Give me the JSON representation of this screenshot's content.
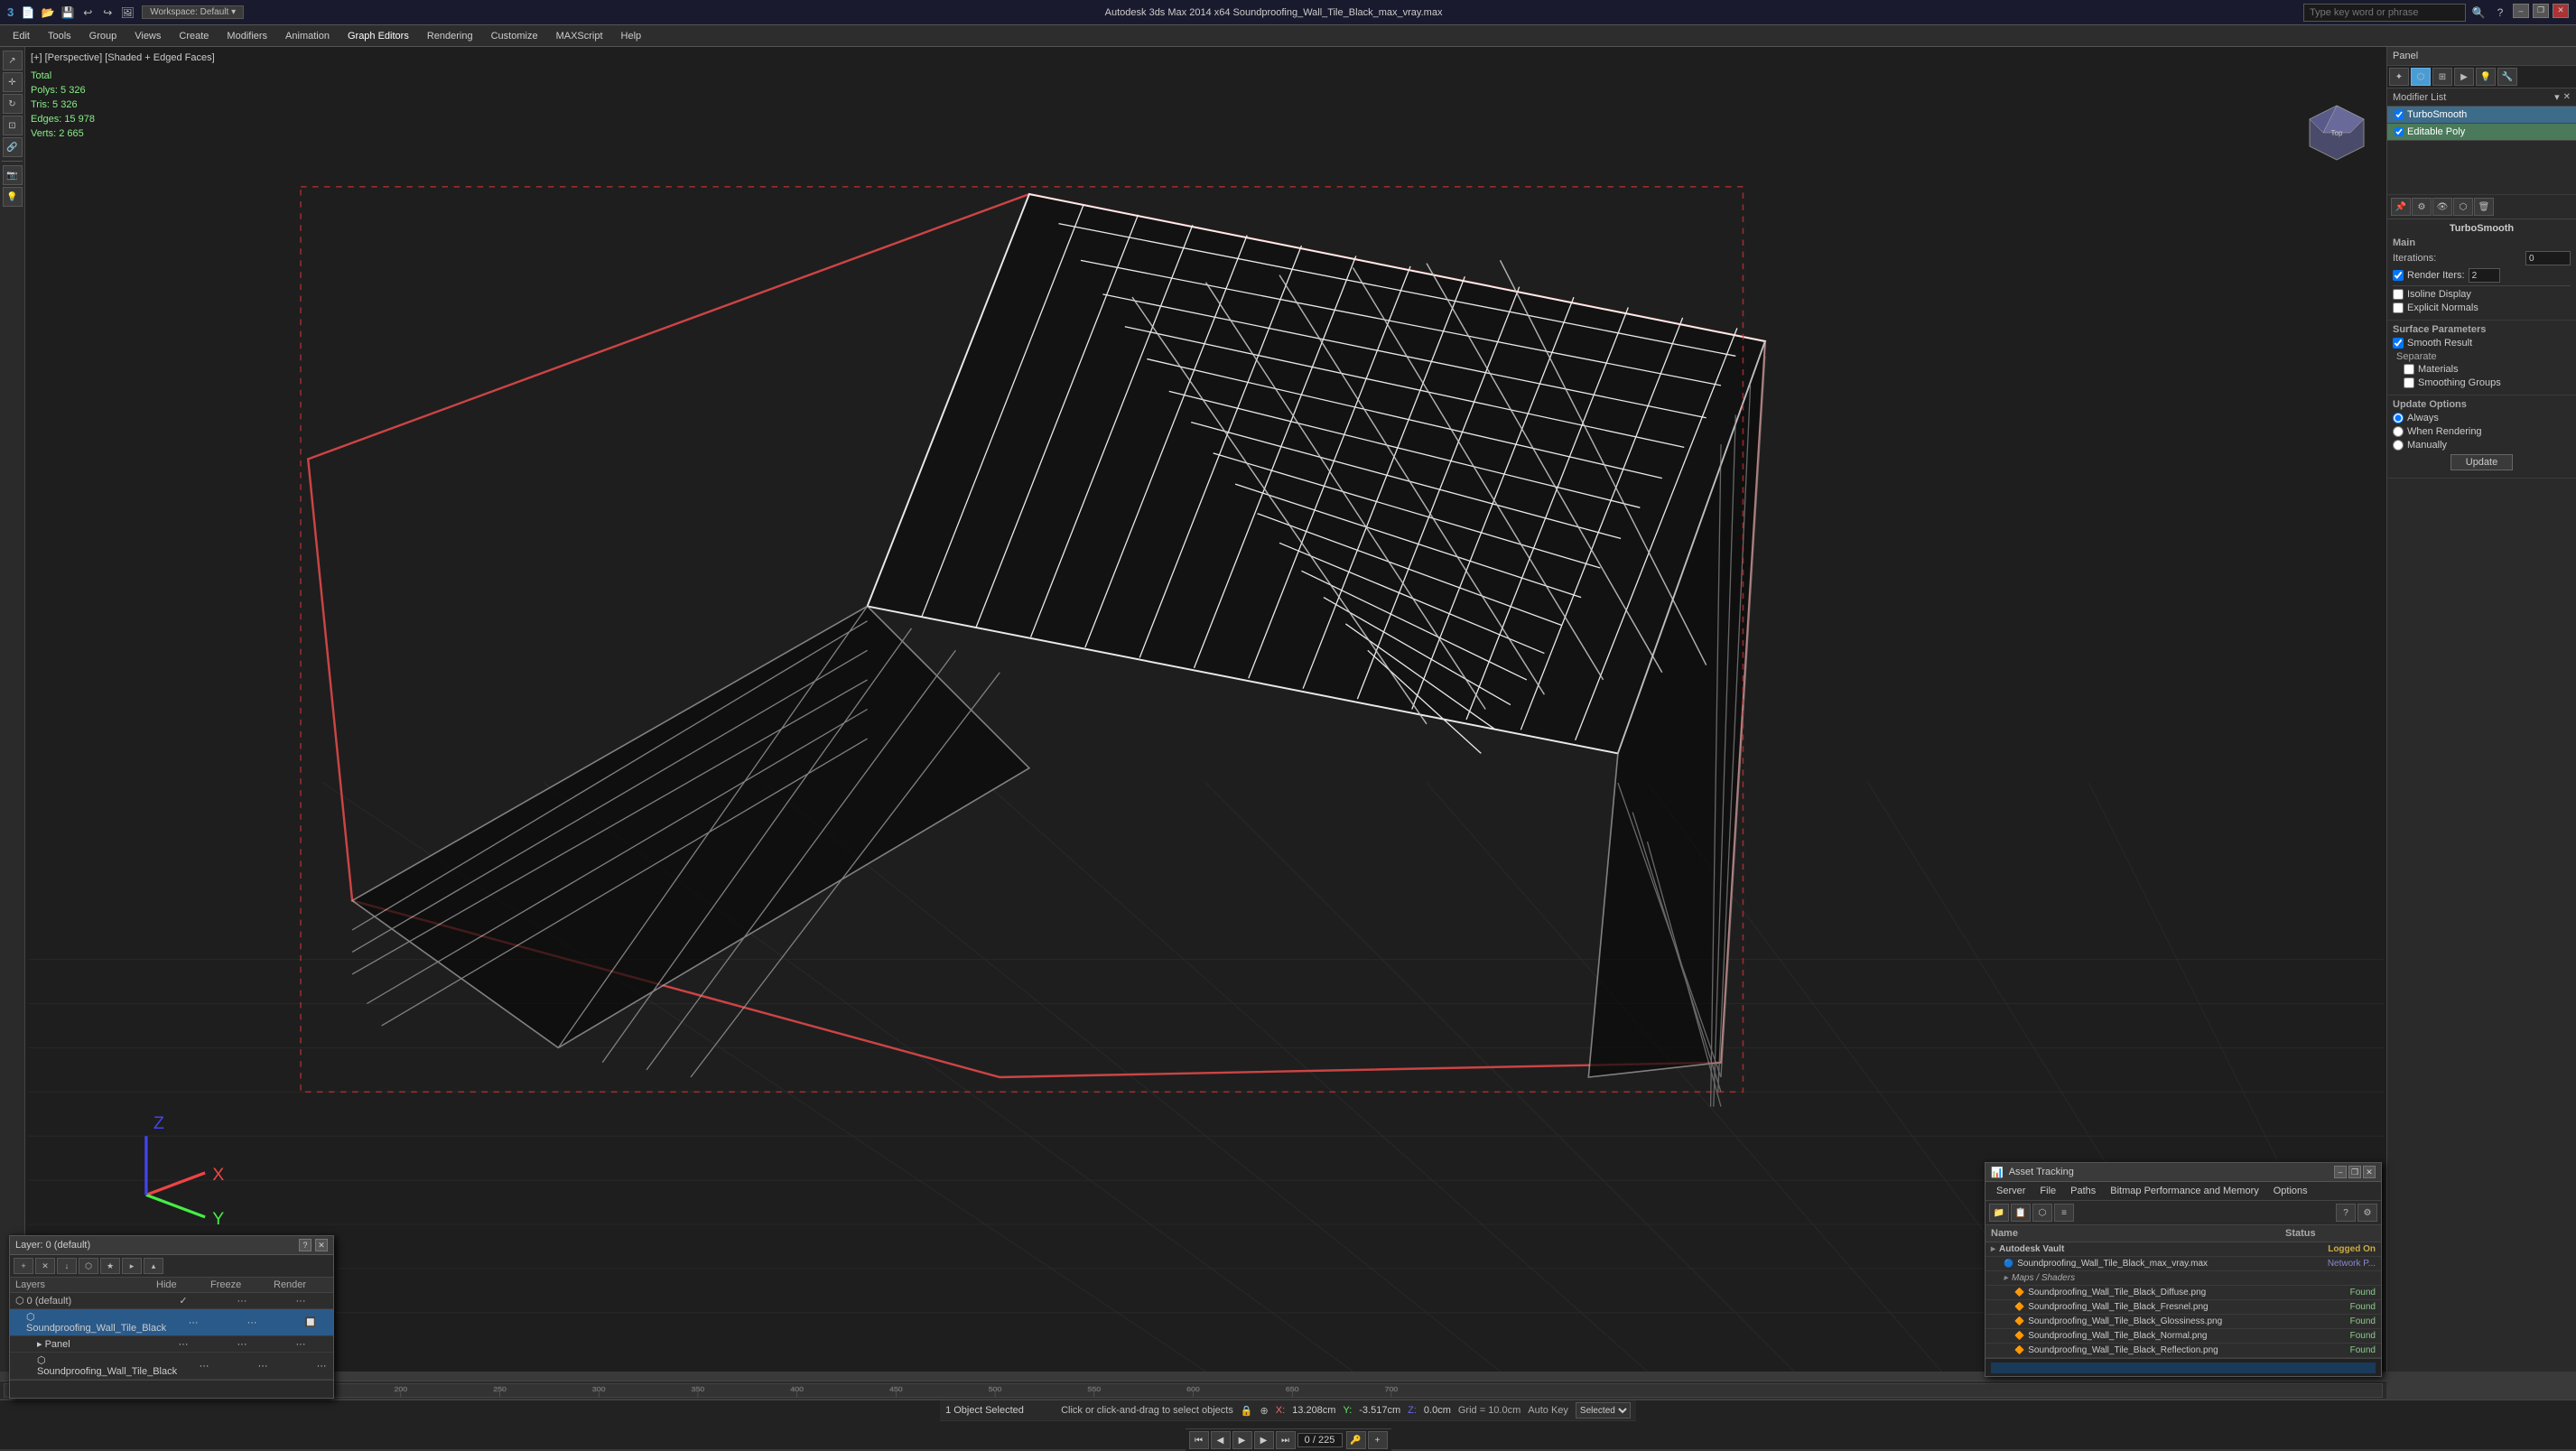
{
  "titlebar": {
    "app_icon": "3ds",
    "title": "Autodesk 3ds Max 2014 x64      Soundproofing_Wall_Tile_Black_max_vray.max",
    "workspace_label": "Workspace: Default",
    "minimize": "–",
    "restore": "❐",
    "close": "✕"
  },
  "search": {
    "placeholder": "Type key word or phrase"
  },
  "menu": {
    "items": [
      "Edit",
      "Tools",
      "Group",
      "Views",
      "Create",
      "Modifiers",
      "Animation",
      "Graph Editors",
      "Rendering",
      "Customize",
      "MAXScript",
      "Help"
    ]
  },
  "viewport": {
    "label": "[+] [Perspective] [Shaded + Edged Faces]",
    "stats": {
      "total_label": "Total",
      "polys_label": "Polys:",
      "polys_value": "5 326",
      "tris_label": "Tris:",
      "tris_value": "5 326",
      "edges_label": "Edges:",
      "edges_value": "15 978",
      "verts_label": "Verts:",
      "verts_value": "2 665"
    }
  },
  "right_panel": {
    "panel_label": "Panel",
    "modifier_list_label": "Modifier List",
    "modifiers": [
      {
        "name": "TurboSmooth",
        "type": "primary"
      },
      {
        "name": "Editable Poly",
        "type": "secondary"
      }
    ],
    "turbosmooth_label": "TurboSmooth",
    "main_section": {
      "title": "Main",
      "iterations_label": "Iterations:",
      "iterations_value": "0",
      "render_iters_label": "Render Iters:",
      "render_iters_value": "2"
    },
    "checkboxes": [
      {
        "label": "Isoline Display",
        "checked": false
      },
      {
        "label": "Explicit Normals",
        "checked": false
      }
    ],
    "surface_params_label": "Surface Parameters",
    "smooth_result_label": "Smooth Result",
    "smooth_result_checked": true,
    "separate_label": "Separate",
    "materials_label": "Materials",
    "materials_checked": false,
    "smoothing_groups_label": "Smoothing Groups",
    "smoothing_groups_checked": false,
    "update_options_label": "Update Options",
    "always_label": "Always",
    "always_checked": true,
    "when_rendering_label": "When Rendering",
    "when_rendering_checked": false,
    "manually_label": "Manually",
    "manually_checked": false,
    "update_btn": "Update"
  },
  "layer_panel": {
    "title": "Layer: 0 (default)",
    "help_btn": "?",
    "close_btn": "✕",
    "columns": [
      "Layers",
      "Hide",
      "Freeze",
      "Render"
    ],
    "rows": [
      {
        "name": "0 (default)",
        "indent": 0,
        "selected": false,
        "is_default": true
      },
      {
        "name": "Soundproofing_Wall_Tile_Black",
        "indent": 1,
        "selected": true
      },
      {
        "name": "Panel",
        "indent": 2,
        "selected": false
      },
      {
        "name": "Soundproofing_Wall_Tile_Black",
        "indent": 2,
        "selected": false
      }
    ]
  },
  "asset_panel": {
    "title": "Asset Tracking",
    "menu_items": [
      "Server",
      "File",
      "Paths",
      "Bitmap Performance and Memory",
      "Options"
    ],
    "columns": [
      "Name",
      "Status"
    ],
    "rows": [
      {
        "name": "Autodesk Vault",
        "indent": 0,
        "type": "group",
        "status": "Logged On",
        "status_type": "logged"
      },
      {
        "name": "Soundproofing_Wall_Tile_Black_max_vray.max",
        "indent": 1,
        "type": "file",
        "status": "Network P...",
        "status_type": "network"
      },
      {
        "name": "Maps / Shaders",
        "indent": 1,
        "type": "subgroup",
        "status": "",
        "status_type": ""
      },
      {
        "name": "Soundproofing_Wall_Tile_Black_Diffuse.png",
        "indent": 2,
        "type": "file",
        "status": "Found",
        "status_type": "found"
      },
      {
        "name": "Soundproofing_Wall_Tile_Black_Fresnel.png",
        "indent": 2,
        "type": "file",
        "status": "Found",
        "status_type": "found"
      },
      {
        "name": "Soundproofing_Wall_Tile_Black_Glossiness.png",
        "indent": 2,
        "type": "file",
        "status": "Found",
        "status_type": "found"
      },
      {
        "name": "Soundproofing_Wall_Tile_Black_Normal.png",
        "indent": 2,
        "type": "file",
        "status": "Found",
        "status_type": "found"
      },
      {
        "name": "Soundproofing_Wall_Tile_Black_Reflection.png",
        "indent": 2,
        "type": "file",
        "status": "Found",
        "status_type": "found"
      }
    ]
  },
  "status_bar": {
    "selected_label": "1 Object Selected",
    "hint": "Click or click-and-drag to select objects",
    "x_label": "X:",
    "x_value": "13.208cm",
    "y_label": "Y:",
    "y_value": "-3.517cm",
    "z_label": "Z:",
    "z_value": "0.0cm",
    "grid_label": "Grid = 10.0cm",
    "autokey_label": "Auto Key",
    "key_mode": "Selected",
    "time_label": "0 / 225"
  }
}
